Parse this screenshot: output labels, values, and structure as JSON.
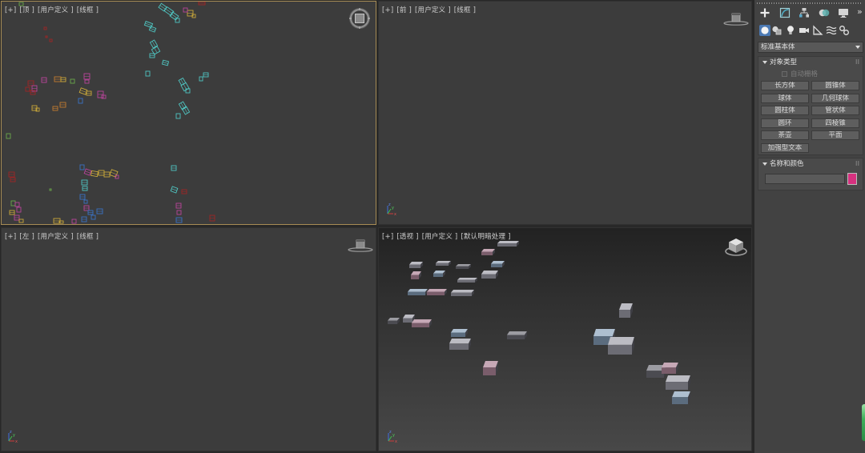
{
  "viewports": {
    "top": {
      "labels": [
        "[+]",
        "[顶 ]",
        "[用户定义 ]",
        "[线框 ]"
      ]
    },
    "front": {
      "labels": [
        "[+]",
        "[前 ]",
        "[用户定义 ]",
        "[线框 ]"
      ]
    },
    "left": {
      "labels": [
        "[+]",
        "[左 ]",
        "[用户定义 ]",
        "[线框 ]"
      ]
    },
    "perspective": {
      "labels": [
        "[+]",
        "[透视 ]",
        "[用户定义 ]",
        "[默认明暗处理 ]"
      ]
    },
    "active": "top"
  },
  "axis_labels": {
    "x": "x",
    "y": "y",
    "z": "z"
  },
  "command_panel": {
    "tabs": [
      "create-icon",
      "modify-icon",
      "hierarchy-icon",
      "motion-icon",
      "display-icon"
    ],
    "more_label": "»",
    "categories": [
      "geometry-icon",
      "shapes-icon",
      "lights-icon",
      "cameras-icon",
      "helpers-icon",
      "space-warps-icon",
      "systems-icon"
    ],
    "active_category": "geometry-icon",
    "dropdown": {
      "selected": "标准基本体"
    },
    "object_type": {
      "title": "对象类型",
      "autogrid": {
        "label": "自动栅格",
        "checked": false,
        "enabled": false
      },
      "buttons": [
        "长方体",
        "圆锥体",
        "球体",
        "几何球体",
        "圆柱体",
        "管状体",
        "圆环",
        "四棱锥",
        "茶壶",
        "平面",
        "加强型文本"
      ]
    },
    "name_and_color": {
      "title": "名称和颜色",
      "name_value": "",
      "color": "#d6317f"
    }
  },
  "colors": {
    "active_viewport_border": "#a68b55",
    "active_category_bg": "#4b79b3",
    "wire_cyan": "#4fc4c0",
    "wire_yellow": "#c9a83a",
    "wire_magenta": "#b8449a",
    "wire_blue": "#3a72c4",
    "wire_red": "#9e2525",
    "wire_green": "#6aa84a",
    "wire_orange": "#c07a30"
  }
}
